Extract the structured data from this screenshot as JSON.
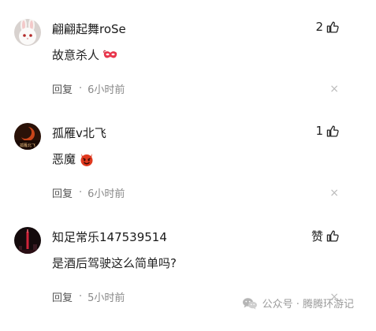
{
  "comments": [
    {
      "username": "翩翩起舞roSe",
      "text": "故意杀人",
      "emoji_icon": "party-mask-emoji-icon",
      "reply_label": "回复",
      "separator": "·",
      "time": "6小时前",
      "like_count": "2",
      "close_label": "×"
    },
    {
      "username": "孤雁v北飞",
      "text": "恶魔",
      "emoji_icon": "devil-emoji-icon",
      "reply_label": "回复",
      "separator": "·",
      "time": "6小时前",
      "like_count": "1",
      "close_label": "×"
    },
    {
      "username": "知足常乐147539514",
      "text": "是酒后驾驶这么简单吗?",
      "emoji_icon": "",
      "reply_label": "回复",
      "separator": "·",
      "time": "5小时前",
      "like_count": "赞",
      "close_label": "×"
    }
  ],
  "watermark": {
    "icon": "wechat-icon",
    "text": "公众号 · 腾腾环游记"
  },
  "colors": {
    "meta": "#888888",
    "close": "#bbbbbb",
    "devil": "#e0391f"
  }
}
